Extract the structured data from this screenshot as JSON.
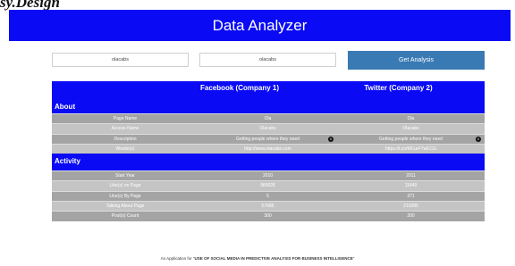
{
  "doc_title": "sy.Design",
  "app": {
    "title": "Data Analyzer"
  },
  "search": {
    "company1_value": "olacabs",
    "company2_value": "olacabs",
    "button_label": "Get Analysis"
  },
  "table": {
    "col1_title": "Facebook (Company 1)",
    "col2_title": "Twitter (Company 2)",
    "about": {
      "label": "About",
      "rows": [
        {
          "label": "Page Name",
          "v1": "Ola",
          "v2": "Ola"
        },
        {
          "label": "Access Name",
          "v1": "Olacabs",
          "v2": "Olacabs"
        },
        {
          "label": "Description",
          "v1": "Getting people where they need",
          "v2": "Getting people where they need"
        },
        {
          "label": "Wesite(s)",
          "v1": "http://www.olacabs.com",
          "v2": "https://t.co/MCurF7wECG"
        }
      ]
    },
    "activity": {
      "label": "Activity",
      "rows": [
        {
          "label": "Start Year",
          "v1": "2010",
          "v2": "2011"
        },
        {
          "label": "Like(s) on Page",
          "v1": "980026",
          "v2": "11649"
        },
        {
          "label": "Like(s) By Page",
          "v1": "5",
          "v2": "371"
        },
        {
          "label": "Talking About Page",
          "v1": "57686",
          "v2": "210286"
        },
        {
          "label": "Post(s) Count",
          "v1": "300",
          "v2": "200"
        }
      ]
    }
  },
  "footer": {
    "prefix": "An Application for \"",
    "title": "USE OF SOCIAL MEDIA IN PREDICTIVE ANALYSIS FOR BUSINESS INTELLIGENCE",
    "suffix": "\""
  },
  "colors": {
    "header_blue": "#0a0af5",
    "button_blue": "#3a7ab4",
    "row_light": "#c4c4c4",
    "row_dark": "#a4a4a4"
  },
  "icons": {
    "info": "info-icon"
  }
}
